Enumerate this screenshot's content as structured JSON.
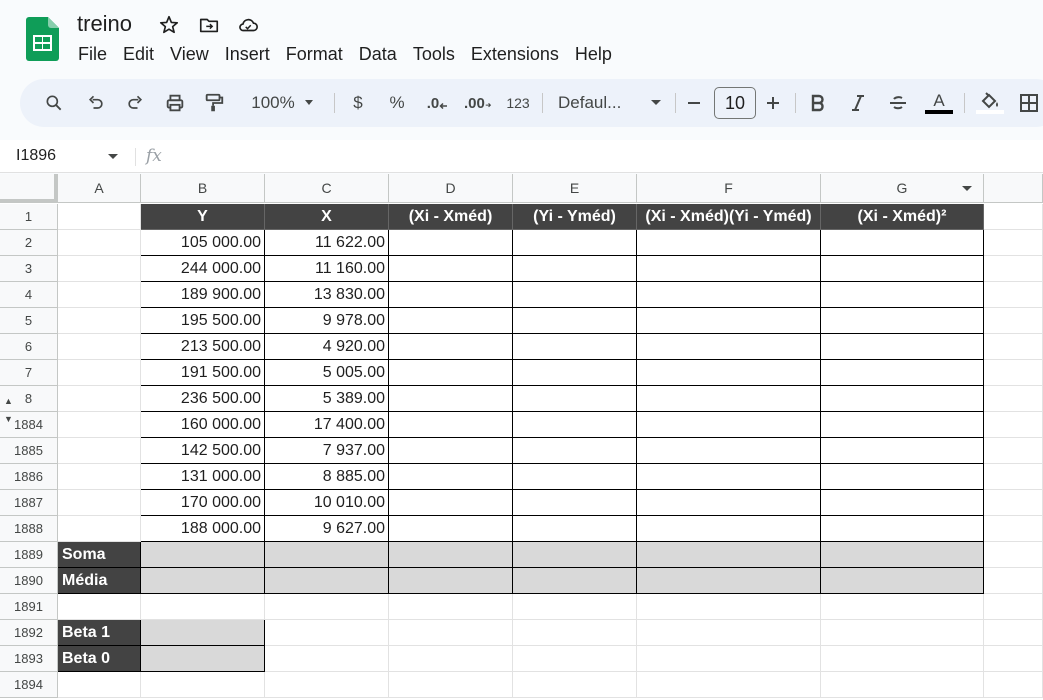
{
  "app": {
    "doc_title": "treino",
    "menu": [
      "File",
      "Edit",
      "View",
      "Insert",
      "Format",
      "Data",
      "Tools",
      "Extensions",
      "Help"
    ]
  },
  "toolbar": {
    "zoom": "100%",
    "currency": "$",
    "percent": "%",
    "decrease_decimal": ".0",
    "increase_decimal": ".00",
    "number_format": "123",
    "font_name": "Defaul...",
    "font_size": "10",
    "text_color_glyph": "A"
  },
  "formula_bar": {
    "name_box": "I1896",
    "fx_label": "fx",
    "value": ""
  },
  "columns": [
    "A",
    "B",
    "C",
    "D",
    "E",
    "F",
    "G"
  ],
  "rows": [
    "1",
    "2",
    "3",
    "4",
    "5",
    "6",
    "7",
    "8",
    "1884",
    "1885",
    "1886",
    "1887",
    "1888",
    "1889",
    "1890",
    "1891",
    "1892",
    "1893",
    "1894"
  ],
  "sheet": {
    "headers": [
      "Y",
      "X",
      "(Xi - Xméd)",
      "(Yi - Yméd)",
      "(Xi - Xméd)(Yi - Yméd)",
      "(Xi - Xméd)²"
    ],
    "y_values": [
      "105 000.00",
      "244 000.00",
      "189 900.00",
      "195 500.00",
      "213 500.00",
      "191 500.00",
      "236 500.00",
      "160 000.00",
      "142 500.00",
      "131 000.00",
      "170 000.00",
      "188 000.00"
    ],
    "x_values": [
      "11 622.00",
      "11 160.00",
      "13 830.00",
      "9 978.00",
      "4 920.00",
      "5 005.00",
      "5 389.00",
      "17 400.00",
      "7 937.00",
      "8 885.00",
      "10 010.00",
      "9 627.00"
    ],
    "soma_label": "Soma",
    "media_label": "Média",
    "beta1_label": "Beta 1",
    "beta0_label": "Beta 0"
  },
  "colors": {
    "header_fill": "#434343",
    "summary_fill": "#d9d9d9",
    "toolbar_bg": "#edf2fa",
    "sheets_green": "#0f9d58"
  },
  "icons": [
    "sheets-logo-icon",
    "star-icon",
    "move-folder-icon",
    "cloud-status-icon",
    "search-icon",
    "undo-icon",
    "redo-icon",
    "print-icon",
    "paint-format-icon",
    "dropdown-icon",
    "bold-icon",
    "italic-icon",
    "strikethrough-icon",
    "text-color-icon",
    "fill-color-icon",
    "borders-icon",
    "minus-icon",
    "plus-icon"
  ]
}
